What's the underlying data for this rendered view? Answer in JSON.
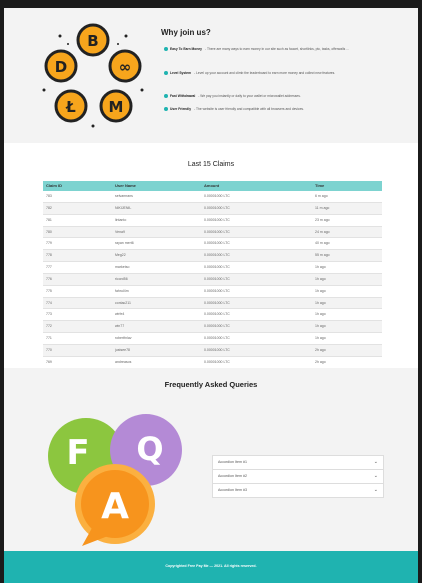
{
  "why": {
    "title": "Why join us?",
    "features": [
      {
        "title": "Easy To Earn Money",
        "text": "- There are many ways to earn money in our site such as faucet, shortlinks, ptc, tasks, offerwalls ..."
      },
      {
        "title": "Level System",
        "text": "- Level up your account and climb the leaderboard to earn more money and collect new features."
      },
      {
        "title": "Fast Withdrawal",
        "text": "- We pay you instantly or daily to your wallet or microwallet addresses."
      },
      {
        "title": "User Friendly",
        "text": "- The website is user friendly and compatible with all browsers and devices."
      }
    ]
  },
  "claims": {
    "title": "Last 15 Claims",
    "headers": [
      "Claim ID",
      "User Name",
      "Amount",
      "Time"
    ],
    "rows": [
      [
        "783",
        "selvamrans",
        "0.00001000 LTC",
        "6 m ago"
      ],
      [
        "782",
        "NIKIJENIL",
        "0.00001000 LTC",
        "11 m ago"
      ],
      [
        "781",
        "lintanto",
        "0.00001000 LTC",
        "23 m ago"
      ],
      [
        "780",
        "Vena9",
        "0.00001000 LTC",
        "24 m ago"
      ],
      [
        "779",
        "rayan mert6",
        "0.00001000 LTC",
        "40 m ago"
      ],
      [
        "778",
        "Meg22",
        "0.00001000 LTC",
        "55 m ago"
      ],
      [
        "777",
        "marketso",
        "0.00001000 LTC",
        "1h ago"
      ],
      [
        "776",
        "ricord56",
        "0.00001000 LTC",
        "1h ago"
      ],
      [
        "775",
        "fahrul4m",
        "0.00001000 LTC",
        "1h ago"
      ],
      [
        "774",
        "contac211",
        "0.00001000 LTC",
        "1h ago"
      ],
      [
        "773",
        "wirfe4",
        "0.00001000 LTC",
        "1h ago"
      ],
      [
        "772",
        "win77",
        "0.00001000 LTC",
        "1h ago"
      ],
      [
        "771",
        "robertfnlav",
        "0.00001000 LTC",
        "1h ago"
      ],
      [
        "770",
        "justsee78",
        "0.00001000 LTC",
        "2h ago"
      ],
      [
        "769",
        "andreasos",
        "0.00001000 LTC",
        "2h ago"
      ]
    ]
  },
  "faq": {
    "title": "Frequently Asked Queries",
    "art_letters": [
      "F",
      "Q",
      "A"
    ],
    "items": [
      "Accordion Item #1",
      "Accordion Item #2",
      "Accordion Item #3"
    ]
  },
  "footer": {
    "text": "Copyrighted Free Pay Me — 2021. All rights reserved."
  },
  "colors": {
    "accent": "#1fb3b0",
    "table_header": "#7dd3d0",
    "coin": "#f7a51c"
  }
}
